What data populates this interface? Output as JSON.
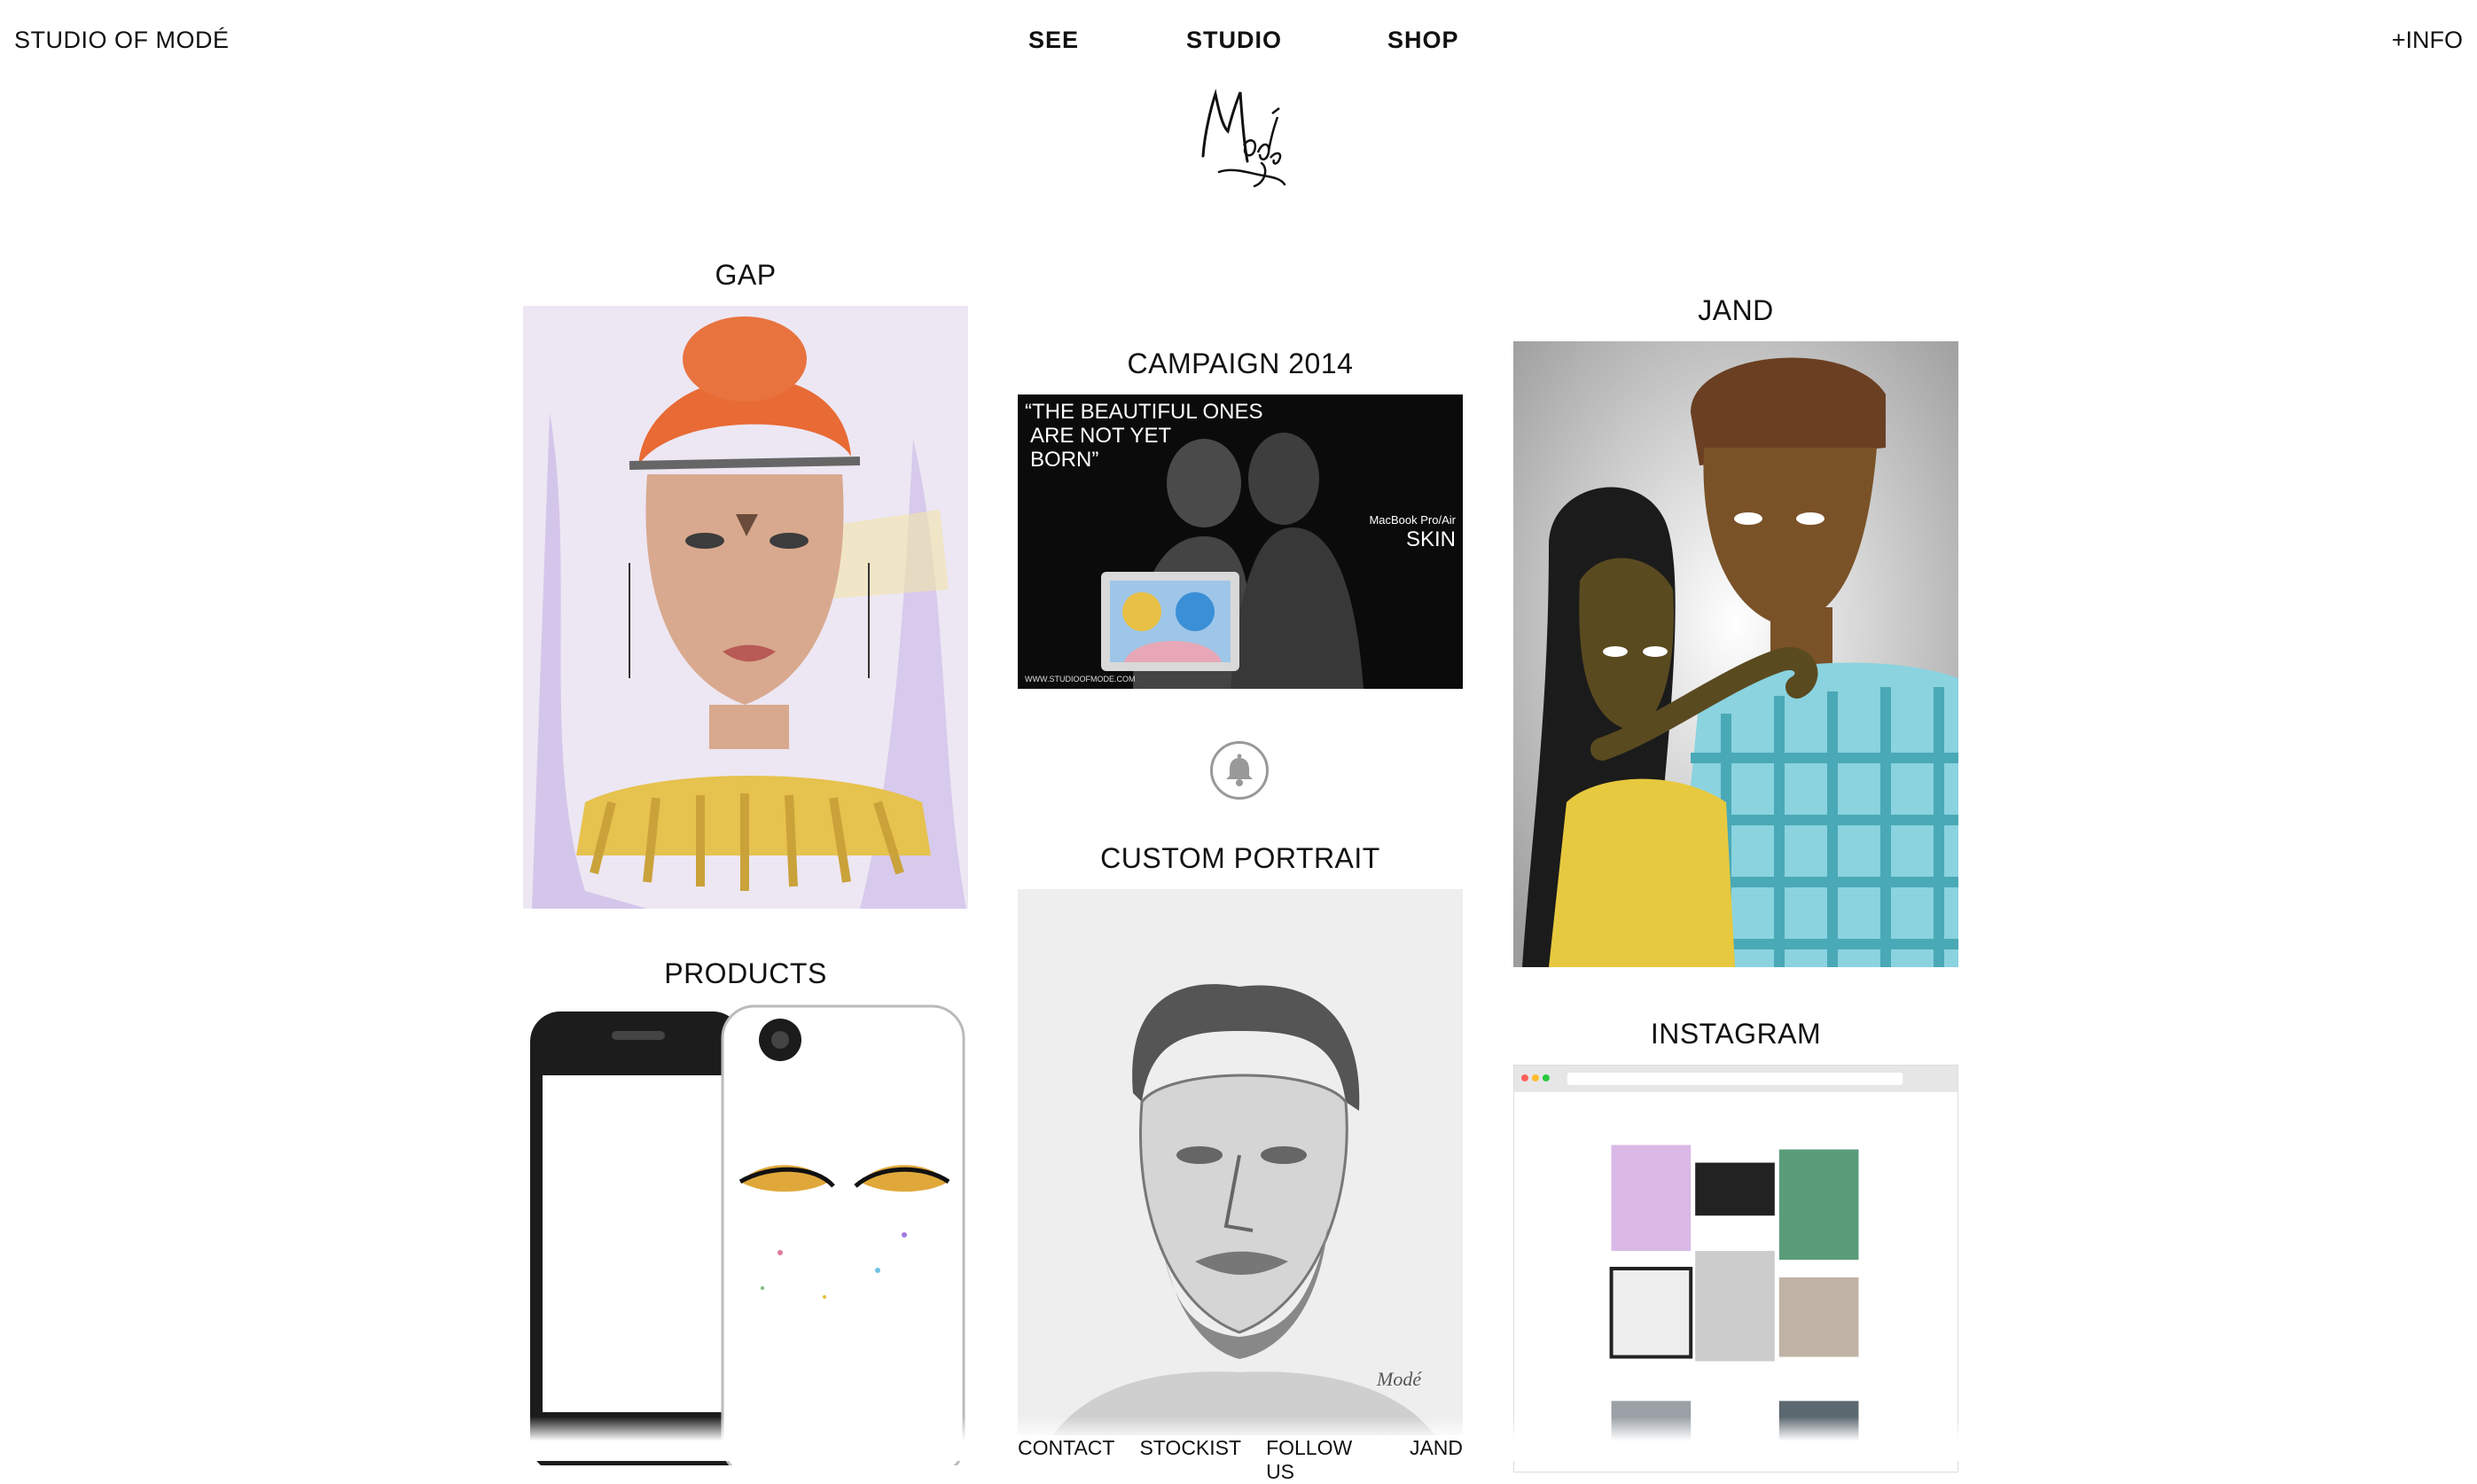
{
  "header": {
    "brand": "STUDIO OF MODÉ",
    "nav": [
      "SEE",
      "STUDIO",
      "SHOP"
    ],
    "info": "+INFO"
  },
  "tiles": {
    "gap": {
      "title": "GAP"
    },
    "campaign": {
      "title": "CAMPAIGN 2014",
      "quote_lines": [
        "“THE BEAUTIFUL ONES",
        "ARE NOT YET",
        "BORN”"
      ],
      "device": "MacBook Pro/Air",
      "product": "SKIN",
      "url": "WWW.STUDIOOFMODE.COM"
    },
    "jand": {
      "title": "JAND"
    },
    "custom": {
      "title": "CUSTOM PORTRAIT"
    },
    "products": {
      "title": "PRODUCTS"
    },
    "instagram": {
      "title": "INSTAGRAM"
    }
  },
  "footer": {
    "links": [
      "CONTACT",
      "STOCKIST",
      "FOLLOW US",
      "JAND"
    ]
  },
  "colors": {
    "text": "#111111",
    "background": "#ffffff",
    "bell_border": "#999999"
  }
}
